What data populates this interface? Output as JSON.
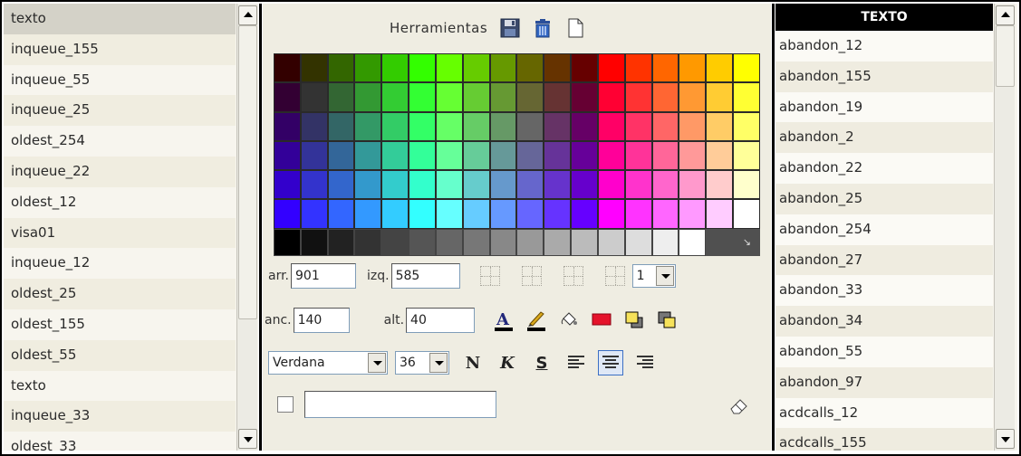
{
  "left_list": {
    "items": [
      {
        "label": "texto"
      },
      {
        "label": "inqueue_155"
      },
      {
        "label": "inqueue_55"
      },
      {
        "label": "inqueue_25"
      },
      {
        "label": "oldest_254"
      },
      {
        "label": "inqueue_22"
      },
      {
        "label": "oldest_12"
      },
      {
        "label": "visa01"
      },
      {
        "label": "inqueue_12"
      },
      {
        "label": "oldest_25"
      },
      {
        "label": "oldest_155"
      },
      {
        "label": "oldest_55"
      },
      {
        "label": "texto"
      },
      {
        "label": "inqueue_33"
      },
      {
        "label": "oldest_33"
      }
    ],
    "selected_index": 0
  },
  "tools": {
    "title": "Herramientas",
    "palette_rows": [
      [
        "#330000",
        "#333300",
        "#336600",
        "#339900",
        "#33cc00",
        "#33ff00",
        "#66ff00",
        "#66cc00",
        "#669900",
        "#666600",
        "#663300",
        "#660000",
        "#ff0000",
        "#ff3300",
        "#ff6600",
        "#ff9900",
        "#ffcc00",
        "#ffff00"
      ],
      [
        "#330033",
        "#333333",
        "#336633",
        "#339933",
        "#33cc33",
        "#33ff33",
        "#66ff33",
        "#66cc33",
        "#669933",
        "#666633",
        "#663333",
        "#660033",
        "#ff0033",
        "#ff3333",
        "#ff6633",
        "#ff9933",
        "#ffcc33",
        "#ffff33"
      ],
      [
        "#330066",
        "#333366",
        "#336666",
        "#339966",
        "#33cc66",
        "#33ff66",
        "#66ff66",
        "#66cc66",
        "#669966",
        "#666666",
        "#663366",
        "#660066",
        "#ff0066",
        "#ff3366",
        "#ff6666",
        "#ff9966",
        "#ffcc66",
        "#ffff66"
      ],
      [
        "#330099",
        "#333399",
        "#336699",
        "#339999",
        "#33cc99",
        "#33ff99",
        "#66ff99",
        "#66cc99",
        "#669999",
        "#666699",
        "#663399",
        "#660099",
        "#ff0099",
        "#ff3399",
        "#ff6699",
        "#ff9999",
        "#ffcc99",
        "#ffff99"
      ],
      [
        "#3300cc",
        "#3333cc",
        "#3366cc",
        "#3399cc",
        "#33cccc",
        "#33ffcc",
        "#66ffcc",
        "#66cccc",
        "#6699cc",
        "#6666cc",
        "#6633cc",
        "#6600cc",
        "#ff00cc",
        "#ff33cc",
        "#ff66cc",
        "#ff99cc",
        "#ffcccc",
        "#ffffcc"
      ],
      [
        "#3300ff",
        "#3333ff",
        "#3366ff",
        "#3399ff",
        "#33ccff",
        "#33ffff",
        "#66ffff",
        "#66ccff",
        "#6699ff",
        "#6666ff",
        "#6633ff",
        "#6600ff",
        "#ff00ff",
        "#ff33ff",
        "#ff66ff",
        "#ff99ff",
        "#ffccff",
        "#ffffff"
      ]
    ],
    "gray_row": [
      "#000000",
      "#111111",
      "#222222",
      "#333333",
      "#444444",
      "#555555",
      "#666666",
      "#777777",
      "#888888",
      "#999999",
      "#aaaaaa",
      "#bbbbbb",
      "#cccccc",
      "#dddddd",
      "#eeeeee",
      "#ffffff"
    ],
    "arr_label": "arr.",
    "arr_value": "901",
    "izq_label": "izq.",
    "izq_value": "585",
    "anc_label": "anc.",
    "anc_value": "140",
    "alt_label": "alt.",
    "alt_value": "40",
    "layer_value": "1",
    "font_value": "Verdana",
    "size_value": "36",
    "bold_glyph": "N",
    "italic_glyph": "K",
    "strike_glyph": "S",
    "text_value": ""
  },
  "right_list": {
    "header": "TEXTO",
    "items": [
      {
        "label": "abandon_12"
      },
      {
        "label": "abandon_155"
      },
      {
        "label": "abandon_19"
      },
      {
        "label": "abandon_2"
      },
      {
        "label": "abandon_22"
      },
      {
        "label": "abandon_25"
      },
      {
        "label": "abandon_254"
      },
      {
        "label": "abandon_27"
      },
      {
        "label": "abandon_33"
      },
      {
        "label": "abandon_34"
      },
      {
        "label": "abandon_55"
      },
      {
        "label": "abandon_97"
      },
      {
        "label": "acdcalls_12"
      },
      {
        "label": "acdcalls_155"
      }
    ]
  }
}
